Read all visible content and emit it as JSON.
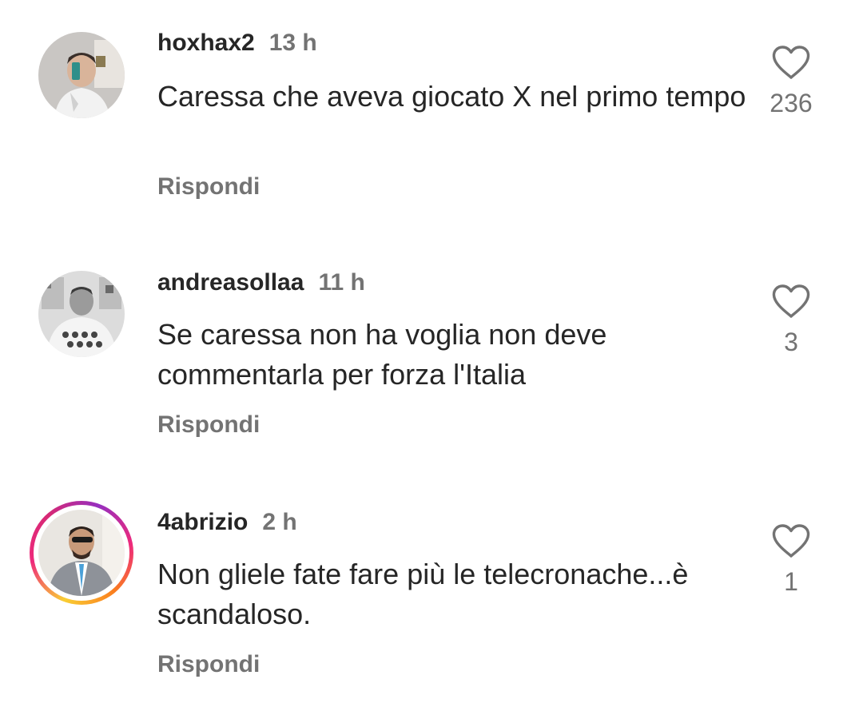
{
  "comments": [
    {
      "username": "hoxhax2",
      "time": "13 h",
      "text": "Caressa che aveva giocato X nel primo tempo",
      "reply_label": "Rispondi",
      "likes": "236",
      "has_story_ring": false
    },
    {
      "username": "andreasollaa",
      "time": "11 h",
      "text": "Se caressa non ha voglia non deve commentarla per forza l'Italia",
      "reply_label": "Rispondi",
      "likes": "3",
      "has_story_ring": false
    },
    {
      "username": "4abrizio",
      "time": "2 h",
      "text": "Non gliele fate fare più le telecronache...è scandaloso.",
      "reply_label": "Rispondi",
      "likes": "1",
      "has_story_ring": true
    }
  ],
  "icons": {
    "like": "heart-outline-icon"
  },
  "colors": {
    "primary_text": "#262626",
    "secondary_text": "#737373",
    "background": "#ffffff"
  }
}
